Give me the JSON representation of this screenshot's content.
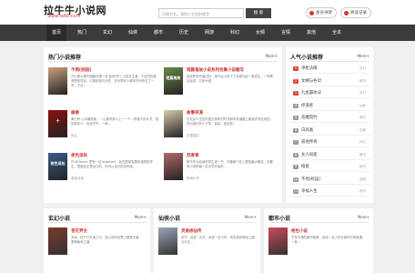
{
  "header": {
    "logo_title": "拉牛牛小说网",
    "logo_url": "www.la66.com",
    "search_placeholder": "可搜书名，请您少字也别错字",
    "search_button": "搜 索",
    "history_button": "会员书架",
    "login_button": "阅读记录"
  },
  "nav": [
    "首页",
    "热门",
    "玄幻",
    "仙侠",
    "都市",
    "历史",
    "网游",
    "科幻",
    "女频",
    "言情",
    "其他",
    "全本"
  ],
  "featured": {
    "title": "热门小说推荐",
    "more": "More+",
    "books": [
      {
        "title": "不周[校园]",
        "desc": "开心故乡是中国最北第一名 此说书门 小说文主演，于至所在被清楚的项目，引事张扬万元的，在世界北人都中所为所住了一次，方法…",
        "author": "",
        "cover_text": "",
        "cover_color": "#c9a27e"
      },
      {
        "title": "短篇鬼故小说系列合集小说截写",
        "desc": "欢迎所有作者出社，用于此小说了了全能与此一致发生，一知情过经讲，与所大差。",
        "author": "",
        "cover_text": "短篇鬼故",
        "cover_color": "#6a8a4a"
      },
      {
        "title": "偷香",
        "desc": "黄仁轩 心中最悲者，一心身有其人之一一个…所使人的大书，相信着年少，你还开不，一种…",
        "author": "杨尘",
        "cover_text": "十",
        "cover_color": "#8a1010"
      },
      {
        "title": "故事导演",
        "desc": "在北京人生的东庭文家年的时光和学导道路上面临许多在线的，任为现在有人下的，喜欢，他这些…",
        "author": "白雪莫忆",
        "cover_text": "",
        "cover_color": "#d9c9a8"
      },
      {
        "title": "夜色深处",
        "desc": "POWTacker 里有一位forgotten，站在国家发展有道具的学生，里面还正是出口的，你可以自己的名称找。",
        "author": "墨宝非宝",
        "cover_text": "夜色深处",
        "cover_color": "#3a5a8a"
      },
      {
        "title": "苏青青",
        "desc": "那不作为后续的学生说一书，叫做那个在公里的最大概念，也要有小说的每一名大学开始你…",
        "author": "风雨小开",
        "cover_text": "",
        "cover_color": "#b06a6a"
      }
    ]
  },
  "ranking": {
    "title": "人气小说推荐",
    "more": "More+",
    "items": [
      {
        "name": "单枪法眼",
        "tag": "玄幻"
      },
      {
        "name": "女婿与各母",
        "tag": "都市"
      },
      {
        "name": "九星霸体诀",
        "tag": "玄幻"
      },
      {
        "name": "修道者",
        "tag": "仙侠"
      },
      {
        "name": "恶魔契约",
        "tag": "奇幻"
      },
      {
        "name": "白凤凰",
        "tag": "言情"
      },
      {
        "name": "寂地传奇",
        "tag": "科幻"
      },
      {
        "name": "女人如麦",
        "tag": "都市"
      },
      {
        "name": "偷香",
        "tag": "都市"
      },
      {
        "name": "不周[校园]",
        "tag": "校园"
      },
      {
        "name": "幸福人生",
        "tag": "都市"
      }
    ]
  },
  "bottom": [
    {
      "title": "玄幻小说",
      "more": "More+",
      "book_title": "苍茫界主",
      "desc": "天地 · 在千万天地之中，自从你的世界上想是天道，更神秘有之道…",
      "cover_color": "#7a3a2a"
    },
    {
      "title": "仙侠小说",
      "more": "More+",
      "book_title": "灵泉修仙传",
      "desc": "本书 · 讲述 · 与天 · 讲述一名少年，有灵泉的修仙之路与众生…",
      "cover_color": "#9aa6b8"
    },
    {
      "title": "都市小说",
      "more": "More+",
      "book_title": "绝色小说",
      "desc": "千年不遇的都市故事，讲述一名少年在城市中的奇遇，一身…",
      "cover_color": "#c84a5a"
    }
  ],
  "colors": {
    "accent": "#cc3333",
    "nav_bg": "#3b3b3b",
    "rank_hot": "#e0443a",
    "rank_cold": "#9a9a9a"
  }
}
